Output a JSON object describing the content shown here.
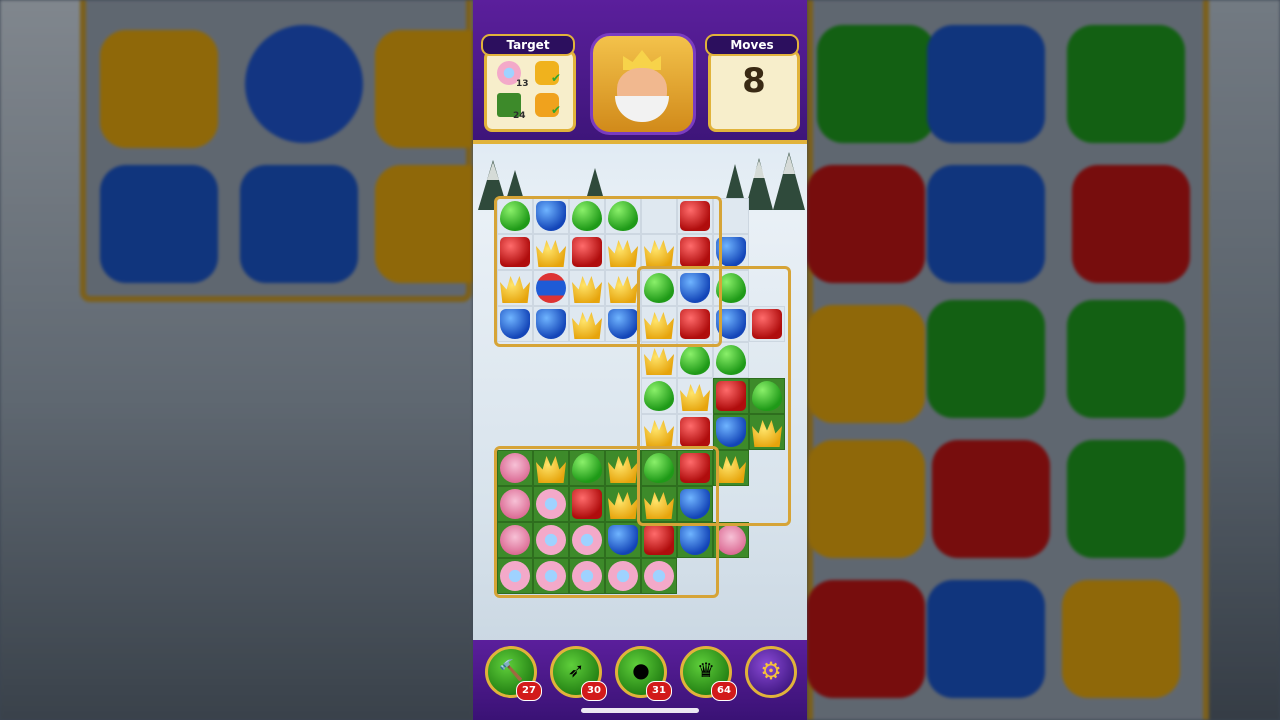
{
  "game": {
    "target": {
      "title": "Target",
      "items": [
        {
          "icon": "pink-shell-icon",
          "count": "13",
          "done": false
        },
        {
          "icon": "ribbon-icon",
          "count": "",
          "done": true
        },
        {
          "icon": "grass-tile-icon",
          "count": "24",
          "done": false
        },
        {
          "icon": "orange-box-icon",
          "count": "",
          "done": true
        }
      ]
    },
    "avatar": {
      "icon": "king-avatar-icon"
    },
    "moves": {
      "title": "Moves",
      "value": "8"
    }
  },
  "boosters": [
    {
      "name": "hammer-booster",
      "icon": "hammer-icon",
      "count": "27"
    },
    {
      "name": "arrow-booster",
      "icon": "arrow-icon",
      "count": "30"
    },
    {
      "name": "cannon-booster",
      "icon": "cannon-icon",
      "count": "31"
    },
    {
      "name": "jester-booster",
      "icon": "jester-hat-icon",
      "count": "64"
    }
  ],
  "settings": {
    "icon": "gear-icon"
  },
  "colors": {
    "topbar": "#5b1f9c",
    "gold_border": "#e1b33b",
    "grass": "#3d8a2a",
    "badge": "#d21a1a"
  }
}
